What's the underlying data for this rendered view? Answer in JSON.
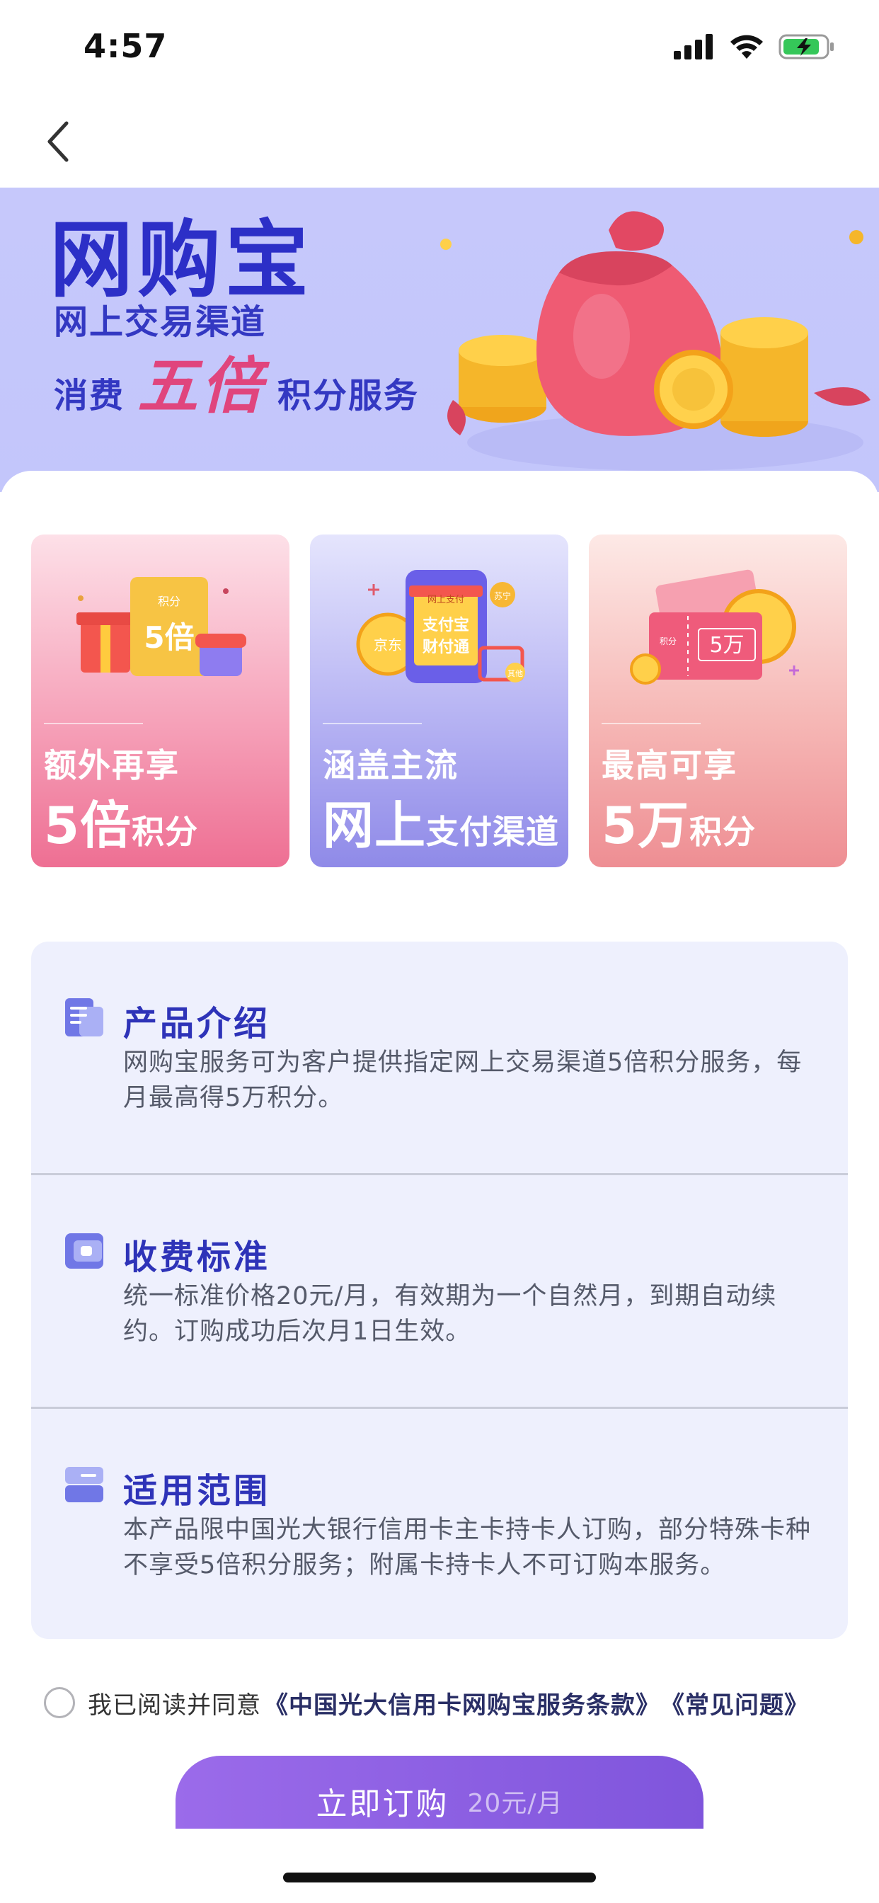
{
  "status_bar": {
    "time": "4:57"
  },
  "banner": {
    "title": "网购宝",
    "subtitle_1": "网上交易渠道",
    "subtitle_2_prefix": "消费",
    "subtitle_2_highlight": "五倍",
    "subtitle_2_suffix": "积分服务"
  },
  "features": [
    {
      "line1": "额外再享",
      "big": "5倍",
      "small": "积分",
      "badge_top": "积分",
      "badge_value": "5倍"
    },
    {
      "line1": "涵盖主流",
      "big": "网上",
      "small": "支付渠道",
      "phone_top": "网上支付",
      "phone_line1": "支付宝",
      "phone_line2": "财付通",
      "coin_left": "京东",
      "tag_right": "苏宁",
      "basket_tag": "其他"
    },
    {
      "line1": "最高可享",
      "big": "5万",
      "small": "积分",
      "ticket_label": "积分",
      "ticket_value": "5万"
    }
  ],
  "info": [
    {
      "title": "产品介绍",
      "text": "网购宝服务可为客户提供指定网上交易渠道5倍积分服务，每月最高得5万积分。",
      "icon": "document-icon"
    },
    {
      "title": "收费标准",
      "text": "统一标准价格20元/月，有效期为一个自然月，到期自动续约。订购成功后次月1日生效。",
      "icon": "wallet-icon"
    },
    {
      "title": "适用范围",
      "text": "本产品限中国光大银行信用卡主卡持卡人订购，部分特殊卡种不享受5倍积分服务；附属卡持卡人不可订购本服务。",
      "icon": "card-icon"
    }
  ],
  "agreement": {
    "prefix": "我已阅读并同意",
    "link_terms": "《中国光大信用卡网购宝服务条款》",
    "link_faq": "《常见问题》"
  },
  "subscribe": {
    "label": "立即订购",
    "price": "20元/月"
  },
  "colors": {
    "brand_blue": "#2c2fc7",
    "accent_pink": "#e0457d",
    "button_purple": "#8a5fe3"
  }
}
